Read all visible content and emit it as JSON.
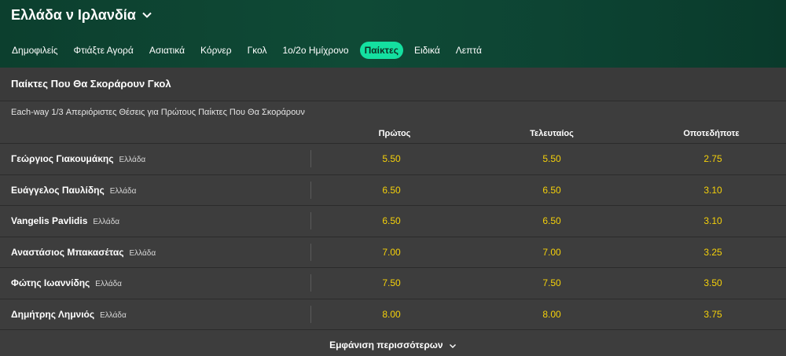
{
  "header": {
    "match_title": "Ελλάδα ν Ιρλανδία",
    "tabs": [
      {
        "label": "Δημοφιλείς",
        "active": false
      },
      {
        "label": "Φτιάξτε Αγορά",
        "active": false
      },
      {
        "label": "Ασιατικά",
        "active": false
      },
      {
        "label": "Κόρνερ",
        "active": false
      },
      {
        "label": "Γκολ",
        "active": false
      },
      {
        "label": "1ο/2ο Ημίχρονο",
        "active": false
      },
      {
        "label": "Παίκτες",
        "active": true
      },
      {
        "label": "Ειδικά",
        "active": false
      },
      {
        "label": "Λεπτά",
        "active": false
      }
    ]
  },
  "market": {
    "title": "Παίκτες Που Θα Σκοράρουν Γκολ",
    "each_way_note": "Each-way 1/3 Απεριόριστες Θέσεις για Πρώτους Παίκτες Που Θα Σκοράρουν",
    "columns": [
      "Πρώτος",
      "Τελευταίος",
      "Οποτεδήποτε"
    ],
    "rows": [
      {
        "name": "Γεώργιος Γιακουμάκης",
        "team": "Ελλάδα",
        "first": "5.50",
        "last": "5.50",
        "anytime": "2.75"
      },
      {
        "name": "Ευάγγελος Παυλίδης",
        "team": "Ελλάδα",
        "first": "6.50",
        "last": "6.50",
        "anytime": "3.10"
      },
      {
        "name": "Vangelis Pavlidis",
        "team": "Ελλάδα",
        "first": "6.50",
        "last": "6.50",
        "anytime": "3.10"
      },
      {
        "name": "Αναστάσιος Μπακασέτας",
        "team": "Ελλάδα",
        "first": "7.00",
        "last": "7.00",
        "anytime": "3.25"
      },
      {
        "name": "Φώτης Ιωαννίδης",
        "team": "Ελλάδα",
        "first": "7.50",
        "last": "7.50",
        "anytime": "3.50"
      },
      {
        "name": "Δημήτρης Λημνιός",
        "team": "Ελλάδα",
        "first": "8.00",
        "last": "8.00",
        "anytime": "3.75"
      }
    ],
    "show_more_label": "Εμφάνιση περισσότερων"
  },
  "icons": {
    "title_chevron": "chevron-down-icon",
    "show_more_chevron": "chevron-down-icon"
  },
  "colors": {
    "odds": "#f5d10a",
    "active_tab": "#14e0a0",
    "header_bg": "#0f4a36",
    "body_bg": "#3d3d3d"
  }
}
